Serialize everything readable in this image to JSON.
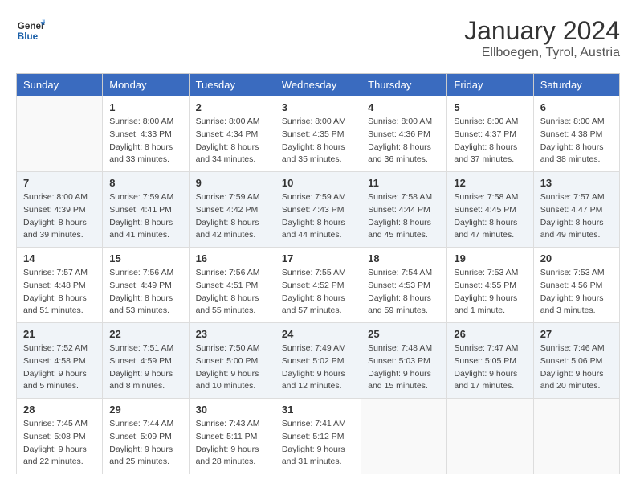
{
  "logo": {
    "line1": "General",
    "line2": "Blue"
  },
  "title": "January 2024",
  "subtitle": "Ellboegen, Tyrol, Austria",
  "weekdays": [
    "Sunday",
    "Monday",
    "Tuesday",
    "Wednesday",
    "Thursday",
    "Friday",
    "Saturday"
  ],
  "weeks": [
    [
      {
        "day": "",
        "info": ""
      },
      {
        "day": "1",
        "info": "Sunrise: 8:00 AM\nSunset: 4:33 PM\nDaylight: 8 hours\nand 33 minutes."
      },
      {
        "day": "2",
        "info": "Sunrise: 8:00 AM\nSunset: 4:34 PM\nDaylight: 8 hours\nand 34 minutes."
      },
      {
        "day": "3",
        "info": "Sunrise: 8:00 AM\nSunset: 4:35 PM\nDaylight: 8 hours\nand 35 minutes."
      },
      {
        "day": "4",
        "info": "Sunrise: 8:00 AM\nSunset: 4:36 PM\nDaylight: 8 hours\nand 36 minutes."
      },
      {
        "day": "5",
        "info": "Sunrise: 8:00 AM\nSunset: 4:37 PM\nDaylight: 8 hours\nand 37 minutes."
      },
      {
        "day": "6",
        "info": "Sunrise: 8:00 AM\nSunset: 4:38 PM\nDaylight: 8 hours\nand 38 minutes."
      }
    ],
    [
      {
        "day": "7",
        "info": "Sunrise: 8:00 AM\nSunset: 4:39 PM\nDaylight: 8 hours\nand 39 minutes."
      },
      {
        "day": "8",
        "info": "Sunrise: 7:59 AM\nSunset: 4:41 PM\nDaylight: 8 hours\nand 41 minutes."
      },
      {
        "day": "9",
        "info": "Sunrise: 7:59 AM\nSunset: 4:42 PM\nDaylight: 8 hours\nand 42 minutes."
      },
      {
        "day": "10",
        "info": "Sunrise: 7:59 AM\nSunset: 4:43 PM\nDaylight: 8 hours\nand 44 minutes."
      },
      {
        "day": "11",
        "info": "Sunrise: 7:58 AM\nSunset: 4:44 PM\nDaylight: 8 hours\nand 45 minutes."
      },
      {
        "day": "12",
        "info": "Sunrise: 7:58 AM\nSunset: 4:45 PM\nDaylight: 8 hours\nand 47 minutes."
      },
      {
        "day": "13",
        "info": "Sunrise: 7:57 AM\nSunset: 4:47 PM\nDaylight: 8 hours\nand 49 minutes."
      }
    ],
    [
      {
        "day": "14",
        "info": "Sunrise: 7:57 AM\nSunset: 4:48 PM\nDaylight: 8 hours\nand 51 minutes."
      },
      {
        "day": "15",
        "info": "Sunrise: 7:56 AM\nSunset: 4:49 PM\nDaylight: 8 hours\nand 53 minutes."
      },
      {
        "day": "16",
        "info": "Sunrise: 7:56 AM\nSunset: 4:51 PM\nDaylight: 8 hours\nand 55 minutes."
      },
      {
        "day": "17",
        "info": "Sunrise: 7:55 AM\nSunset: 4:52 PM\nDaylight: 8 hours\nand 57 minutes."
      },
      {
        "day": "18",
        "info": "Sunrise: 7:54 AM\nSunset: 4:53 PM\nDaylight: 8 hours\nand 59 minutes."
      },
      {
        "day": "19",
        "info": "Sunrise: 7:53 AM\nSunset: 4:55 PM\nDaylight: 9 hours\nand 1 minute."
      },
      {
        "day": "20",
        "info": "Sunrise: 7:53 AM\nSunset: 4:56 PM\nDaylight: 9 hours\nand 3 minutes."
      }
    ],
    [
      {
        "day": "21",
        "info": "Sunrise: 7:52 AM\nSunset: 4:58 PM\nDaylight: 9 hours\nand 5 minutes."
      },
      {
        "day": "22",
        "info": "Sunrise: 7:51 AM\nSunset: 4:59 PM\nDaylight: 9 hours\nand 8 minutes."
      },
      {
        "day": "23",
        "info": "Sunrise: 7:50 AM\nSunset: 5:00 PM\nDaylight: 9 hours\nand 10 minutes."
      },
      {
        "day": "24",
        "info": "Sunrise: 7:49 AM\nSunset: 5:02 PM\nDaylight: 9 hours\nand 12 minutes."
      },
      {
        "day": "25",
        "info": "Sunrise: 7:48 AM\nSunset: 5:03 PM\nDaylight: 9 hours\nand 15 minutes."
      },
      {
        "day": "26",
        "info": "Sunrise: 7:47 AM\nSunset: 5:05 PM\nDaylight: 9 hours\nand 17 minutes."
      },
      {
        "day": "27",
        "info": "Sunrise: 7:46 AM\nSunset: 5:06 PM\nDaylight: 9 hours\nand 20 minutes."
      }
    ],
    [
      {
        "day": "28",
        "info": "Sunrise: 7:45 AM\nSunset: 5:08 PM\nDaylight: 9 hours\nand 22 minutes."
      },
      {
        "day": "29",
        "info": "Sunrise: 7:44 AM\nSunset: 5:09 PM\nDaylight: 9 hours\nand 25 minutes."
      },
      {
        "day": "30",
        "info": "Sunrise: 7:43 AM\nSunset: 5:11 PM\nDaylight: 9 hours\nand 28 minutes."
      },
      {
        "day": "31",
        "info": "Sunrise: 7:41 AM\nSunset: 5:12 PM\nDaylight: 9 hours\nand 31 minutes."
      },
      {
        "day": "",
        "info": ""
      },
      {
        "day": "",
        "info": ""
      },
      {
        "day": "",
        "info": ""
      }
    ]
  ]
}
